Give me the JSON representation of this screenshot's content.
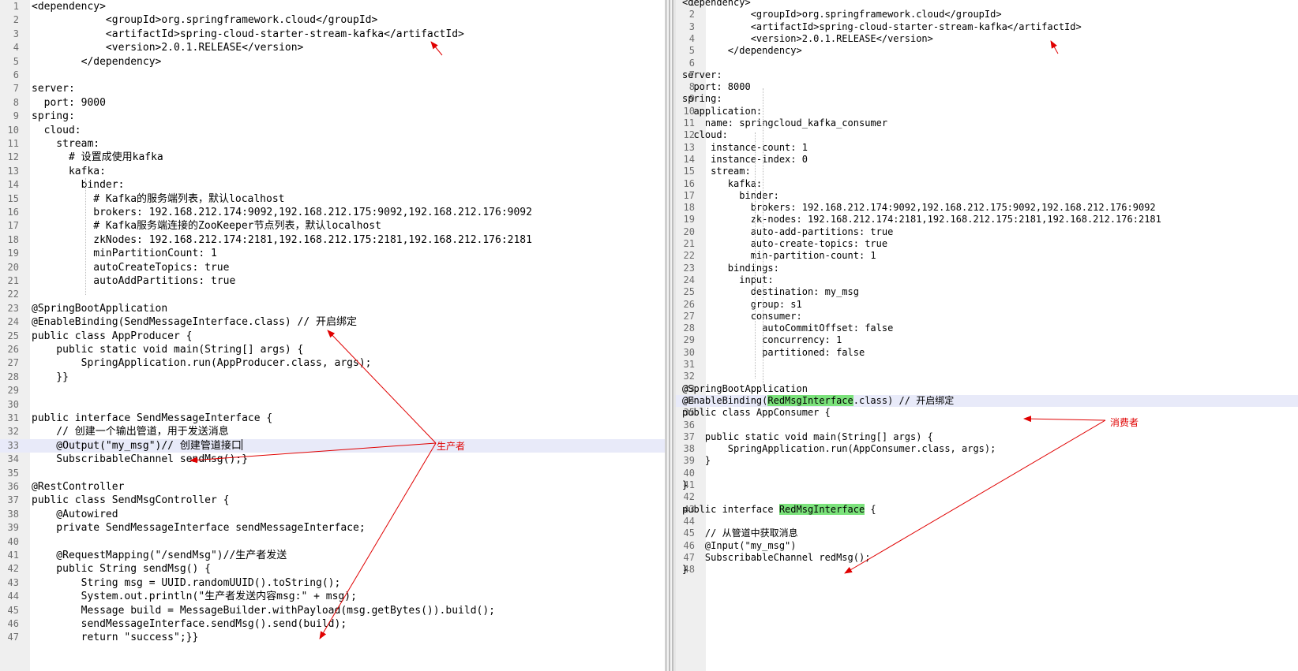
{
  "left_editor": {
    "lines": [
      {
        "n": "1",
        "t": "<dependency>"
      },
      {
        "n": "2",
        "t": "            <groupId>org.springframework.cloud</groupId>"
      },
      {
        "n": "3",
        "t": "            <artifactId>spring-cloud-starter-stream-kafka</artifactId>"
      },
      {
        "n": "4",
        "t": "            <version>2.0.1.RELEASE</version>"
      },
      {
        "n": "5",
        "t": "        </dependency>"
      },
      {
        "n": "6",
        "t": ""
      },
      {
        "n": "7",
        "t": "server:"
      },
      {
        "n": "8",
        "t": "  port: 9000"
      },
      {
        "n": "9",
        "t": "spring:"
      },
      {
        "n": "10",
        "t": "  cloud:"
      },
      {
        "n": "11",
        "t": "    stream:"
      },
      {
        "n": "12",
        "t": "      # 设置成使用kafka"
      },
      {
        "n": "13",
        "t": "      kafka:"
      },
      {
        "n": "14",
        "t": "        binder:"
      },
      {
        "n": "15",
        "t": "          # Kafka的服务端列表，默认localhost"
      },
      {
        "n": "16",
        "t": "          brokers: 192.168.212.174:9092,192.168.212.175:9092,192.168.212.176:9092"
      },
      {
        "n": "17",
        "t": "          # Kafka服务端连接的ZooKeeper节点列表，默认localhost"
      },
      {
        "n": "18",
        "t": "          zkNodes: 192.168.212.174:2181,192.168.212.175:2181,192.168.212.176:2181"
      },
      {
        "n": "19",
        "t": "          minPartitionCount: 1"
      },
      {
        "n": "20",
        "t": "          autoCreateTopics: true"
      },
      {
        "n": "21",
        "t": "          autoAddPartitions: true"
      },
      {
        "n": "22",
        "t": ""
      },
      {
        "n": "23",
        "t": "@SpringBootApplication"
      },
      {
        "n": "24",
        "t": "@EnableBinding(SendMessageInterface.class) // 开启绑定"
      },
      {
        "n": "25",
        "t": "public class AppProducer {"
      },
      {
        "n": "26",
        "t": "    public static void main(String[] args) {"
      },
      {
        "n": "27",
        "t": "        SpringApplication.run(AppProducer.class, args);"
      },
      {
        "n": "28",
        "t": "    }}"
      },
      {
        "n": "29",
        "t": ""
      },
      {
        "n": "30",
        "t": ""
      },
      {
        "n": "31",
        "t": "public interface SendMessageInterface {"
      },
      {
        "n": "32",
        "t": "    // 创建一个输出管道，用于发送消息"
      },
      {
        "n": "33",
        "t": "    @Output(\"my_msg\")// 创建管道接口"
      },
      {
        "n": "34",
        "t": "    SubscribableChannel sendMsg();}"
      },
      {
        "n": "35",
        "t": ""
      },
      {
        "n": "36",
        "t": "@RestController"
      },
      {
        "n": "37",
        "t": "public class SendMsgController {"
      },
      {
        "n": "38",
        "t": "    @Autowired"
      },
      {
        "n": "39",
        "t": "    private SendMessageInterface sendMessageInterface;"
      },
      {
        "n": "40",
        "t": ""
      },
      {
        "n": "41",
        "t": "    @RequestMapping(\"/sendMsg\")//生产者发送"
      },
      {
        "n": "42",
        "t": "    public String sendMsg() {"
      },
      {
        "n": "43",
        "t": "        String msg = UUID.randomUUID().toString();"
      },
      {
        "n": "44",
        "t": "        System.out.println(\"生产者发送内容msg:\" + msg);"
      },
      {
        "n": "45",
        "t": "        Message build = MessageBuilder.withPayload(msg.getBytes()).build();"
      },
      {
        "n": "46",
        "t": "        sendMessageInterface.sendMsg().send(build);"
      },
      {
        "n": "47",
        "t": "        return \"success\";}}"
      }
    ],
    "highlighted_line": "33"
  },
  "right_editor": {
    "lines": [
      {
        "n": "1",
        "t": "<dependency>"
      },
      {
        "n": "2",
        "t": "            <groupId>org.springframework.cloud</groupId>"
      },
      {
        "n": "3",
        "t": "            <artifactId>spring-cloud-starter-stream-kafka</artifactId>"
      },
      {
        "n": "4",
        "t": "            <version>2.0.1.RELEASE</version>"
      },
      {
        "n": "5",
        "t": "        </dependency>"
      },
      {
        "n": "6",
        "t": ""
      },
      {
        "n": "7",
        "t": "server:"
      },
      {
        "n": "8",
        "t": "  port: 8000"
      },
      {
        "n": "9",
        "t": "spring:"
      },
      {
        "n": "10",
        "t": "  application:"
      },
      {
        "n": "11",
        "t": "    name: springcloud_kafka_consumer"
      },
      {
        "n": "12",
        "t": "  cloud:"
      },
      {
        "n": "13",
        "t": "     instance-count: 1"
      },
      {
        "n": "14",
        "t": "     instance-index: 0"
      },
      {
        "n": "15",
        "t": "     stream:"
      },
      {
        "n": "16",
        "t": "        kafka:"
      },
      {
        "n": "17",
        "t": "          binder:"
      },
      {
        "n": "18",
        "t": "            brokers: 192.168.212.174:9092,192.168.212.175:9092,192.168.212.176:9092"
      },
      {
        "n": "19",
        "t": "            zk-nodes: 192.168.212.174:2181,192.168.212.175:2181,192.168.212.176:2181"
      },
      {
        "n": "20",
        "t": "            auto-add-partitions: true"
      },
      {
        "n": "21",
        "t": "            auto-create-topics: true"
      },
      {
        "n": "22",
        "t": "            min-partition-count: 1"
      },
      {
        "n": "23",
        "t": "        bindings:"
      },
      {
        "n": "24",
        "t": "          input:"
      },
      {
        "n": "25",
        "t": "            destination: my_msg"
      },
      {
        "n": "26",
        "t": "            group: s1"
      },
      {
        "n": "27",
        "t": "            consumer:"
      },
      {
        "n": "28",
        "t": "              autoCommitOffset: false"
      },
      {
        "n": "29",
        "t": "              concurrency: 1"
      },
      {
        "n": "30",
        "t": "              partitioned: false"
      },
      {
        "n": "31",
        "t": ""
      },
      {
        "n": "32",
        "t": ""
      },
      {
        "n": "33",
        "t": "@SpringBootApplication"
      },
      {
        "n": "34",
        "t": "@EnableBinding(RedMsgInterface.class) // 开启绑定"
      },
      {
        "n": "35",
        "t": "public class AppConsumer {"
      },
      {
        "n": "36",
        "t": ""
      },
      {
        "n": "37",
        "t": "    public static void main(String[] args) {"
      },
      {
        "n": "38",
        "t": "        SpringApplication.run(AppConsumer.class, args);"
      },
      {
        "n": "39",
        "t": "    }"
      },
      {
        "n": "40",
        "t": ""
      },
      {
        "n": "41",
        "t": "}"
      },
      {
        "n": "42",
        "t": ""
      },
      {
        "n": "43",
        "t": "public interface RedMsgInterface {"
      },
      {
        "n": "44",
        "t": ""
      },
      {
        "n": "45",
        "t": "    // 从管道中获取消息"
      },
      {
        "n": "46",
        "t": "    @Input(\"my_msg\")"
      },
      {
        "n": "47",
        "t": "    SubscribableChannel redMsg();"
      },
      {
        "n": "48",
        "t": "}"
      }
    ],
    "highlighted_line": "34"
  },
  "annotations": {
    "producer_label": "生产者",
    "consumer_label": "消费者",
    "arrow_color": "#e00000"
  }
}
